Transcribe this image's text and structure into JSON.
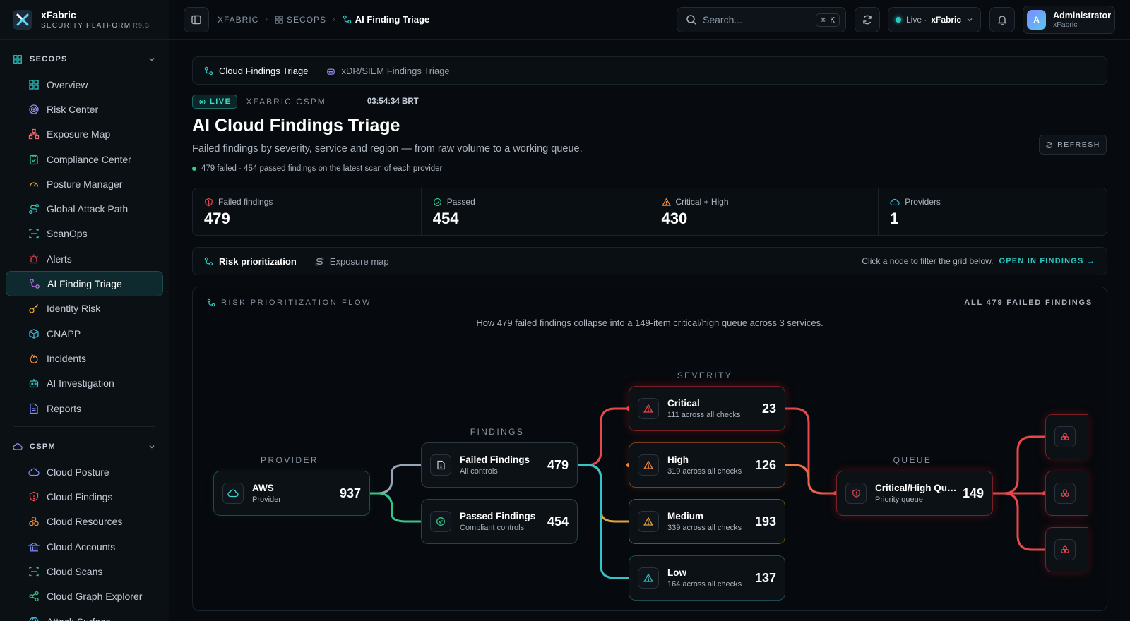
{
  "brand": {
    "name": "xFabric",
    "subtitle": "SECURITY PLATFORM",
    "version": "R9.3"
  },
  "sidebar": {
    "sections": [
      {
        "label": "SECOPS",
        "items": [
          {
            "label": "Overview",
            "icon": "grid-icon"
          },
          {
            "label": "Risk Center",
            "icon": "target-icon"
          },
          {
            "label": "Exposure Map",
            "icon": "network-icon"
          },
          {
            "label": "Compliance Center",
            "icon": "clipboard-check-icon"
          },
          {
            "label": "Posture Manager",
            "icon": "gauge-icon"
          },
          {
            "label": "Global Attack Path",
            "icon": "route-icon"
          },
          {
            "label": "ScanOps",
            "icon": "scan-icon"
          },
          {
            "label": "Alerts",
            "icon": "siren-icon"
          },
          {
            "label": "AI Finding Triage",
            "icon": "workflow-icon",
            "active": true
          },
          {
            "label": "Identity Risk",
            "icon": "key-icon"
          },
          {
            "label": "CNAPP",
            "icon": "box-icon"
          },
          {
            "label": "Incidents",
            "icon": "flame-icon"
          },
          {
            "label": "AI Investigation",
            "icon": "bot-icon"
          },
          {
            "label": "Reports",
            "icon": "file-icon"
          }
        ]
      },
      {
        "label": "CSPM",
        "items": [
          {
            "label": "Cloud Posture",
            "icon": "cloud-icon"
          },
          {
            "label": "Cloud Findings",
            "icon": "shield-alert-icon"
          },
          {
            "label": "Cloud Resources",
            "icon": "boxes-icon"
          },
          {
            "label": "Cloud Accounts",
            "icon": "bank-icon"
          },
          {
            "label": "Cloud Scans",
            "icon": "scan-icon"
          },
          {
            "label": "Cloud Graph Explorer",
            "icon": "share-icon"
          },
          {
            "label": "Attack Surface",
            "icon": "globe-icon"
          }
        ]
      }
    ]
  },
  "topbar": {
    "breadcrumb": [
      "XFABRIC",
      "SECOPS",
      "AI Finding Triage"
    ],
    "search_placeholder": "Search...",
    "search_shortcut": "⌘ K",
    "live_label": "Live ·",
    "workspace": "xFabric",
    "user_name": "Administrator",
    "user_org": "xFabric",
    "user_initial": "A"
  },
  "tabs": [
    {
      "label": "Cloud Findings Triage",
      "active": true
    },
    {
      "label": "xDR/SIEM Findings Triage",
      "active": false
    }
  ],
  "header": {
    "live_badge": "LIVE",
    "source": "XFABRIC CSPM",
    "time": "03:54:34 BRT",
    "title": "AI Cloud Findings Triage",
    "description": "Failed findings by severity, service and region — from raw volume to a working queue.",
    "summary": "479 failed · 454 passed findings on the latest scan of each provider",
    "refresh_label": "REFRESH"
  },
  "stats": [
    {
      "label": "Failed findings",
      "value": "479",
      "icon": "shield-alert-icon",
      "color": "#e5484d"
    },
    {
      "label": "Passed",
      "value": "454",
      "icon": "check-circle-icon",
      "color": "#35c58a"
    },
    {
      "label": "Critical + High",
      "value": "430",
      "icon": "warning-icon",
      "color": "#f08a3c"
    },
    {
      "label": "Providers",
      "value": "1",
      "icon": "cloud-icon",
      "color": "#3bb8d6"
    }
  ],
  "view_bar": {
    "tabs": [
      {
        "label": "Risk prioritization",
        "active": true
      },
      {
        "label": "Exposure map",
        "active": false
      }
    ],
    "hint": "Click a node to filter the grid below.",
    "link": "OPEN IN FINDINGS →"
  },
  "flow": {
    "title": "RISK PRIORITIZATION FLOW",
    "scope": "ALL 479 FAILED FINDINGS",
    "caption": "How 479 failed findings collapse into a 149-item critical/high queue across 3 services.",
    "columns": {
      "provider": "PROVIDER",
      "findings": "FINDINGS",
      "severity": "SEVERITY",
      "queue": "QUEUE"
    },
    "nodes": {
      "aws": {
        "name": "AWS",
        "sub": "Provider",
        "value": "937"
      },
      "failed": {
        "name": "Failed Findings",
        "sub": "All controls",
        "value": "479"
      },
      "passed": {
        "name": "Passed Findings",
        "sub": "Compliant controls",
        "value": "454"
      },
      "critical": {
        "name": "Critical",
        "sub": "111 across all checks",
        "value": "23"
      },
      "high": {
        "name": "High",
        "sub": "319 across all checks",
        "value": "126"
      },
      "medium": {
        "name": "Medium",
        "sub": "339 across all checks",
        "value": "193"
      },
      "low": {
        "name": "Low",
        "sub": "164 across all checks",
        "value": "137"
      },
      "queue": {
        "name": "Critical/High Queue",
        "sub": "Priority queue",
        "value": "149"
      }
    }
  }
}
